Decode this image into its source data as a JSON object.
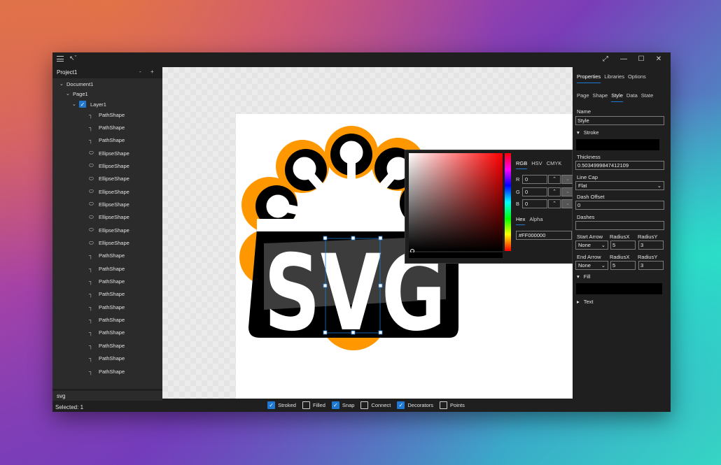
{
  "project": {
    "title": "Project1",
    "minus": "-",
    "plus": "+"
  },
  "tree": {
    "document": "Document1",
    "page": "Page1",
    "layer": "Layer1",
    "items": [
      "PathShape",
      "PathShape",
      "PathShape",
      "EllipseShape",
      "EllipseShape",
      "EllipseShape",
      "EllipseShape",
      "EllipseShape",
      "EllipseShape",
      "EllipseShape",
      "EllipseShape",
      "PathShape",
      "PathShape",
      "PathShape",
      "PathShape",
      "PathShape",
      "PathShape",
      "PathShape",
      "PathShape",
      "PathShape",
      "PathShape"
    ],
    "item_icons": [
      "path-icon",
      "path-icon",
      "path-icon",
      "ellipse-icon",
      "ellipse-icon",
      "ellipse-icon",
      "ellipse-icon",
      "ellipse-icon",
      "ellipse-icon",
      "ellipse-icon",
      "ellipse-icon",
      "path-icon",
      "path-icon",
      "path-icon",
      "path-icon",
      "path-icon",
      "path-icon",
      "path-icon",
      "path-icon",
      "path-icon",
      "path-icon"
    ]
  },
  "left_input": "svg",
  "status": "Selected: 1",
  "canvas": {
    "logo_text": "SVG"
  },
  "picker": {
    "tabs": [
      "RGB",
      "HSV",
      "CMYK"
    ],
    "active_tab": "RGB",
    "r_label": "R",
    "r_value": "0",
    "g_label": "G",
    "g_value": "0",
    "b_label": "B",
    "b_value": "0",
    "hex_tabs": [
      "Hex",
      "Alpha"
    ],
    "hex_value": "#FF000000"
  },
  "bottombar": [
    {
      "label": "Stroked",
      "checked": true
    },
    {
      "label": "Filled",
      "checked": false
    },
    {
      "label": "Snap",
      "checked": true
    },
    {
      "label": "Connect",
      "checked": false
    },
    {
      "label": "Decorators",
      "checked": true
    },
    {
      "label": "Points",
      "checked": false
    }
  ],
  "right": {
    "tabs": [
      "Properties",
      "Libraries",
      "Options"
    ],
    "subtabs": [
      "Page",
      "Shape",
      "Style",
      "Data",
      "State"
    ],
    "name_label": "Name",
    "name_value": "Style",
    "stroke_label": "Stroke",
    "thickness_label": "Thickness",
    "thickness_value": "0.5034999847412109",
    "linecap_label": "Line Cap",
    "linecap_value": "Flat",
    "dashoffset_label": "Dash Offset",
    "dashoffset_value": "0",
    "dashes_label": "Dashes",
    "dashes_value": "",
    "start_arrow_label": "Start Arrow",
    "end_arrow_label": "End Arrow",
    "radiusx_label": "RadiusX",
    "radiusy_label": "RadiusY",
    "start_arrow_value": "None",
    "start_rx": "5",
    "start_ry": "3",
    "end_arrow_value": "None",
    "end_rx": "5",
    "end_ry": "3",
    "fill_label": "Fill",
    "text_label": "Text"
  },
  "colors": {
    "accent": "#1f78d1",
    "logo_orange": "#ff9800",
    "logo_black": "#000000",
    "logo_gray": "#3c3c3c"
  }
}
